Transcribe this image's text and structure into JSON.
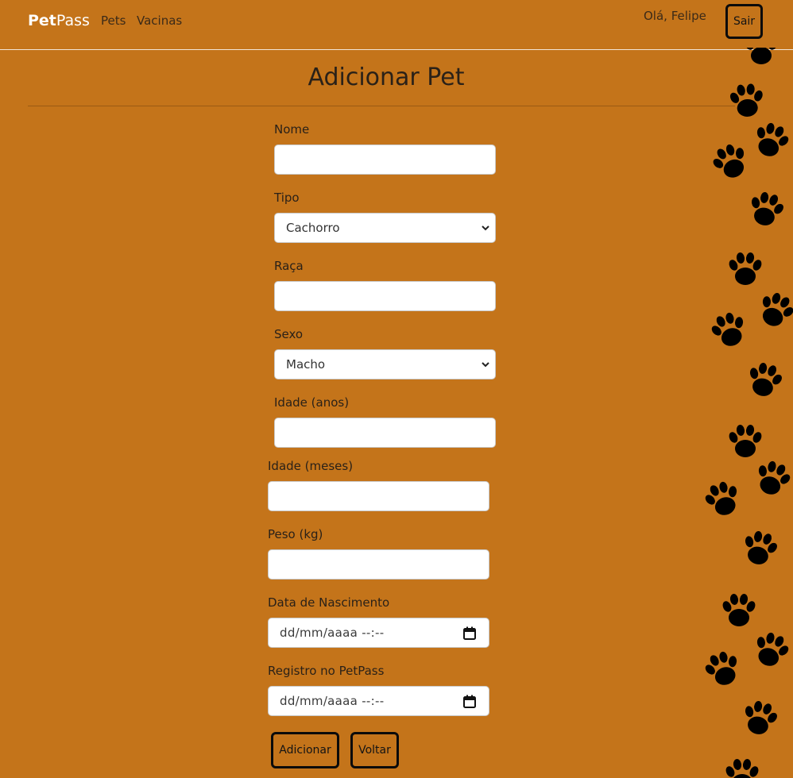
{
  "navbar": {
    "brand_bold": "Pet",
    "brand_rest": "Pass",
    "links": [
      "Pets",
      "Vacinas"
    ],
    "greeting": "Olá, Felipe",
    "logout_label": "Sair"
  },
  "page": {
    "title": "Adicionar Pet"
  },
  "form": {
    "nome": {
      "label": "Nome",
      "value": ""
    },
    "tipo": {
      "label": "Tipo",
      "selected": "Cachorro"
    },
    "raca": {
      "label": "Raça",
      "value": ""
    },
    "sexo": {
      "label": "Sexo",
      "selected": "Macho"
    },
    "idade_anos": {
      "label": "Idade (anos)",
      "value": ""
    },
    "idade_meses": {
      "label": "Idade (meses)",
      "value": ""
    },
    "peso": {
      "label": "Peso (kg)",
      "value": ""
    },
    "data_nascimento": {
      "label": "Data de Nascimento",
      "placeholder": "dd/mm/aaaa --:--"
    },
    "registro": {
      "label": "Registro no PetPass",
      "placeholder": "dd/mm/aaaa --:--"
    }
  },
  "buttons": {
    "submit": "Adicionar",
    "back": "Voltar"
  },
  "icons": {
    "background_decoration": "paw-print-icon",
    "select_arrow": "chevron-down-icon",
    "date_picker": "calendar-icon"
  },
  "colors": {
    "background": "#c4741a",
    "paw": "#000000",
    "button_border": "#0b0b0b"
  }
}
